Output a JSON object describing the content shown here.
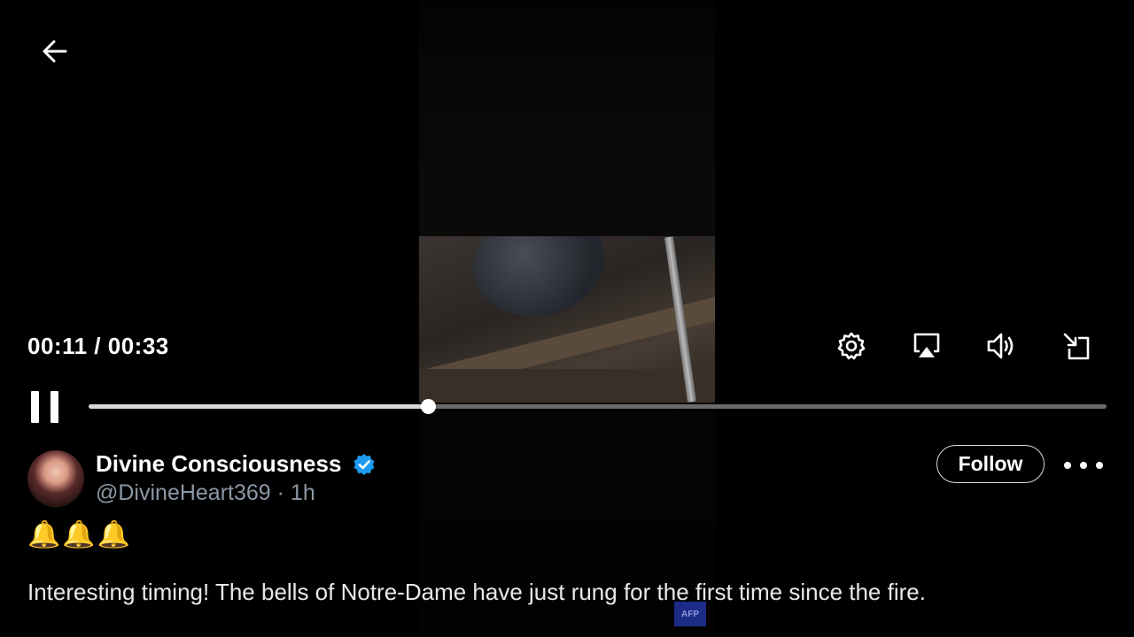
{
  "player": {
    "current_time": "00:11",
    "duration": "00:33",
    "time_display": "00:11 / 00:33",
    "progress": 0.3333,
    "watermark": "AFP",
    "controls": {
      "back_icon": "arrow-left-icon",
      "settings_icon": "gear-icon",
      "airplay_icon": "airplay-icon",
      "volume_icon": "volume-icon",
      "exit_fullscreen_icon": "exit-fullscreen-icon",
      "pause_icon": "pause-icon"
    }
  },
  "post": {
    "display_name": "Divine Consciousness",
    "verified": true,
    "handle": "@DivineHeart369",
    "separator": "·",
    "time_ago": "1h",
    "handle_line": "@DivineHeart369 · 1h",
    "follow_label": "Follow",
    "emoji_line": "🔔🔔🔔",
    "text": "Interesting timing! The bells of Notre-Dame have just rung for the first time since the fire."
  },
  "colors": {
    "background": "#000000",
    "verified_badge": "#1d9bf0",
    "secondary_text": "#8b98a5"
  }
}
